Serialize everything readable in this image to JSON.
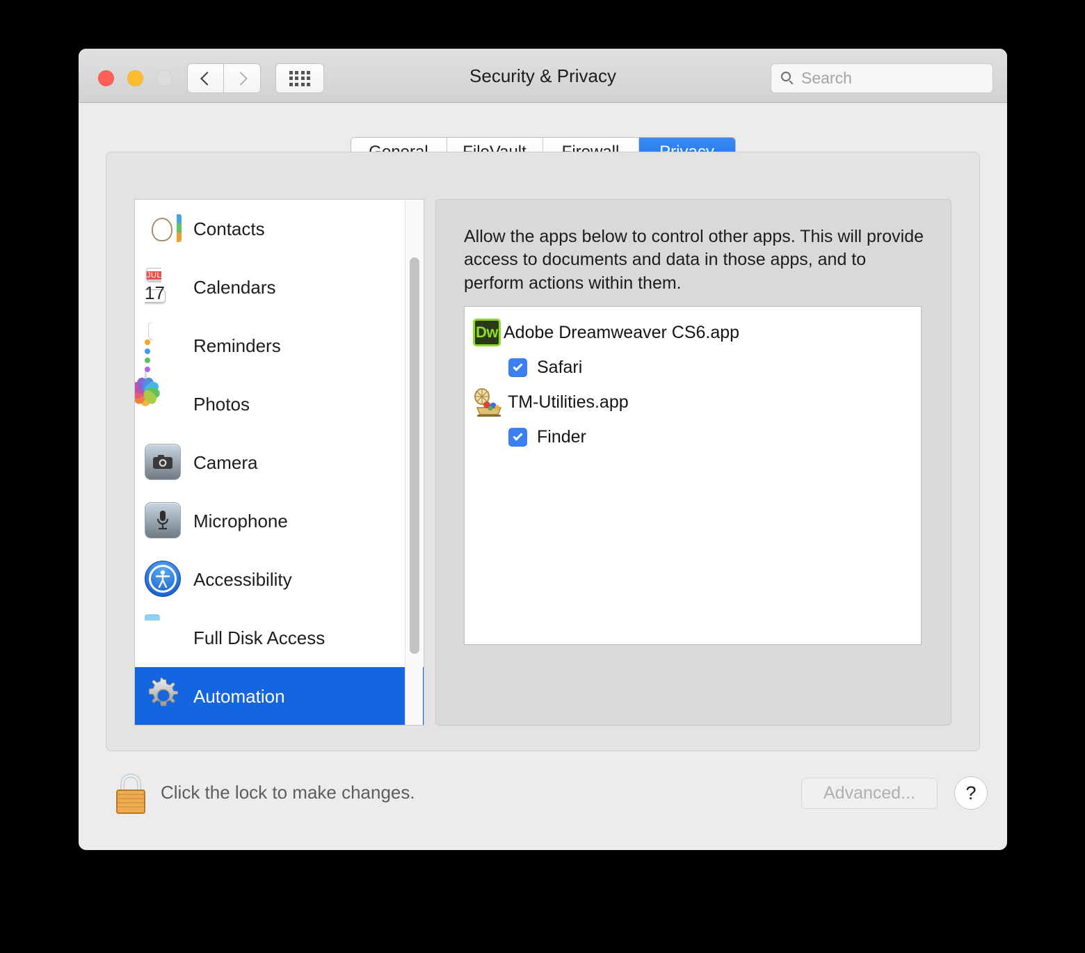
{
  "window": {
    "title": "Security & Privacy",
    "traffic_lights": [
      "close",
      "minimize",
      "zoom"
    ],
    "nav": {
      "back": "back-chevron",
      "forward": "forward-chevron",
      "grid": "show-all-grid"
    }
  },
  "search": {
    "placeholder": "Search",
    "value": "",
    "icon": "search-icon"
  },
  "tabs": [
    {
      "label": "General",
      "active": false
    },
    {
      "label": "FileVault",
      "active": false
    },
    {
      "label": "Firewall",
      "active": false
    },
    {
      "label": "Privacy",
      "active": true
    }
  ],
  "sidebar": {
    "items": [
      {
        "label": "Contacts",
        "icon": "contacts-icon",
        "selected": false
      },
      {
        "label": "Calendars",
        "icon": "calendar-icon",
        "selected": false
      },
      {
        "label": "Reminders",
        "icon": "reminders-icon",
        "selected": false
      },
      {
        "label": "Photos",
        "icon": "photos-icon",
        "selected": false
      },
      {
        "label": "Camera",
        "icon": "camera-icon",
        "selected": false
      },
      {
        "label": "Microphone",
        "icon": "microphone-icon",
        "selected": false
      },
      {
        "label": "Accessibility",
        "icon": "accessibility-icon",
        "selected": false
      },
      {
        "label": "Full Disk Access",
        "icon": "folder-icon",
        "selected": false
      },
      {
        "label": "Automation",
        "icon": "gear-icon",
        "selected": true
      }
    ],
    "calendar_icon": {
      "month": "JUL",
      "day": "17"
    }
  },
  "content": {
    "description": "Allow the apps below to control other apps. This will provide access to documents and data in those apps, and to perform actions within them.",
    "apps": [
      {
        "name": "Adobe Dreamweaver CS6.app",
        "icon": "dreamweaver-icon",
        "icon_text": "Dw",
        "children": [
          {
            "name": "Safari",
            "checked": true
          }
        ]
      },
      {
        "name": "TM-Utilities.app",
        "icon": "tm-utilities-icon",
        "children": [
          {
            "name": "Finder",
            "checked": true
          }
        ]
      }
    ]
  },
  "bottom": {
    "lock_icon": "lock-closed-icon",
    "lock_text": "Click the lock to make changes.",
    "advanced_label": "Advanced...",
    "advanced_disabled": true,
    "help_label": "?"
  },
  "colors": {
    "accent_blue": "#1565e0",
    "tab_active": "#1a72ec",
    "checkbox_blue": "#3a80f2",
    "window_bg": "#ececec",
    "panel_bg": "#e3e3e3",
    "content_bg": "#d9d9d9"
  }
}
